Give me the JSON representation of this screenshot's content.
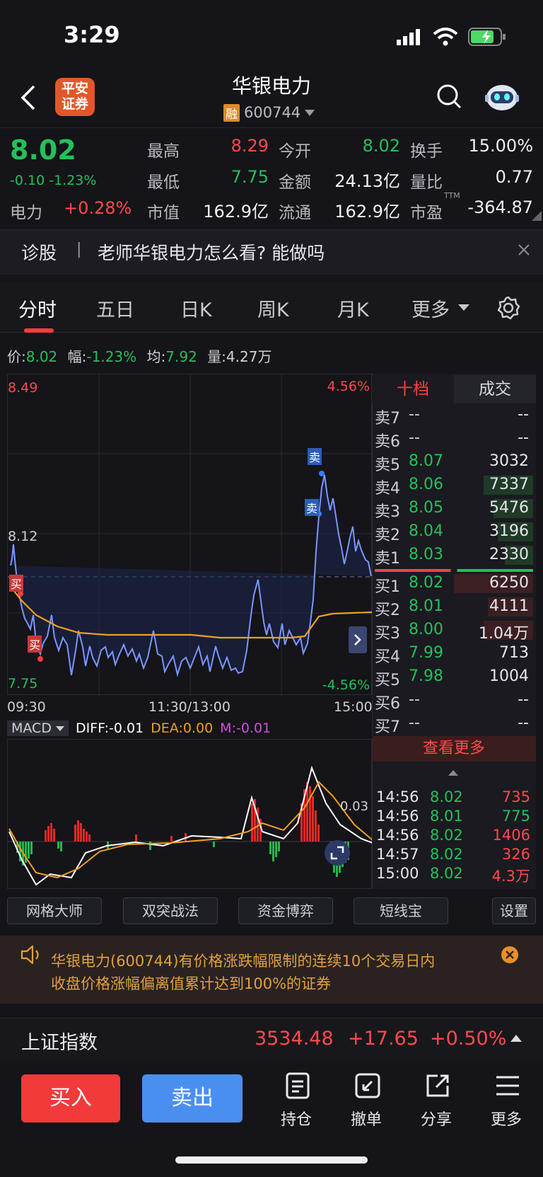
{
  "status": {
    "time": "3:29"
  },
  "header": {
    "logo_line1": "平安",
    "logo_line2": "证券",
    "title": "华银电力",
    "margin_badge": "融",
    "code": "600744"
  },
  "quote": {
    "price": "8.02",
    "change": "-0.10",
    "change_pct": "-1.23%",
    "sector_name": "电力",
    "sector_pct": "+0.28%",
    "high_lbl": "最高",
    "high": "8.29",
    "open_lbl": "今开",
    "open": "8.02",
    "turnover_lbl": "换手",
    "turnover": "15.00%",
    "low_lbl": "最低",
    "low": "7.75",
    "amount_lbl": "金额",
    "amount": "24.13亿",
    "vratio_lbl": "量比",
    "vratio": "0.77",
    "mcap_lbl": "市值",
    "mcap": "162.9亿",
    "float_lbl": "流通",
    "float": "162.9亿",
    "pe_lbl": "市盈",
    "pe_sup": "TTM",
    "pe": "-364.87"
  },
  "ask_bar": {
    "label": "诊股",
    "sep": "|",
    "question": "老师华银电力怎么看? 能做吗"
  },
  "tabs": {
    "t1": "分时",
    "t2": "五日",
    "t3": "日K",
    "t4": "周K",
    "t5": "月K",
    "t6": "更多"
  },
  "info_line": {
    "price_lbl": "价:",
    "price": "8.02",
    "amp_lbl": "幅:",
    "amp": "-1.23%",
    "avg_lbl": "均:",
    "avg": "7.92",
    "vol_lbl": "量:",
    "vol": "4.27万"
  },
  "chart_labels": {
    "top_price": "8.49",
    "top_pct": "4.56%",
    "mid_price": "8.12",
    "bottom_price": "7.75",
    "bottom_pct": "-4.56%",
    "t_start": "09:30",
    "t_mid": "11:30/13:00",
    "t_end": "15:00",
    "buy_mark": "买",
    "sell_mark": "卖"
  },
  "macd": {
    "name": "MACD",
    "diff": "DIFF:-0.01",
    "dea": "DEA:0.00",
    "m": "M:-0.01",
    "side_val": "0.03"
  },
  "orderbook": {
    "tab_active": "十档",
    "tab_other": "成交",
    "asks": [
      {
        "lbl": "卖7",
        "price": "--",
        "vol": "--"
      },
      {
        "lbl": "卖6",
        "price": "--",
        "vol": "--"
      },
      {
        "lbl": "卖5",
        "price": "8.07",
        "vol": "3032"
      },
      {
        "lbl": "卖4",
        "price": "8.06",
        "vol": "7337"
      },
      {
        "lbl": "卖3",
        "price": "8.05",
        "vol": "5476"
      },
      {
        "lbl": "卖2",
        "price": "8.04",
        "vol": "3196"
      },
      {
        "lbl": "卖1",
        "price": "8.03",
        "vol": "2330"
      }
    ],
    "bids": [
      {
        "lbl": "买1",
        "price": "8.02",
        "vol": "6250"
      },
      {
        "lbl": "买2",
        "price": "8.01",
        "vol": "4111"
      },
      {
        "lbl": "买3",
        "price": "8.00",
        "vol": "1.04万"
      },
      {
        "lbl": "买4",
        "price": "7.99",
        "vol": "713"
      },
      {
        "lbl": "买5",
        "price": "7.98",
        "vol": "1004"
      },
      {
        "lbl": "买6",
        "price": "--",
        "vol": "--"
      },
      {
        "lbl": "买7",
        "price": "--",
        "vol": "--"
      }
    ],
    "more": "查看更多",
    "trades": [
      {
        "t": "14:56",
        "p": "8.02",
        "v": "735"
      },
      {
        "t": "14:56",
        "p": "8.01",
        "v": "775"
      },
      {
        "t": "14:56",
        "p": "8.02",
        "v": "1406"
      },
      {
        "t": "14:57",
        "p": "8.02",
        "v": "326"
      },
      {
        "t": "15:00",
        "p": "8.02",
        "v": "4.3万"
      }
    ]
  },
  "tools": {
    "b1": "网格大师",
    "b2": "双突战法",
    "b3": "资金博弈",
    "b4": "短线宝",
    "b5": "设置"
  },
  "notice": {
    "line1": "华银电力(600744)有价格涨跌幅限制的连续10个交易日内",
    "line2": "收盘价格涨幅偏离值累计达到100%的证券"
  },
  "index": {
    "name": "上证指数",
    "value": "3534.48",
    "chg": "+17.65",
    "pct": "+0.50%"
  },
  "footer": {
    "buy": "买入",
    "sell": "卖出",
    "hold": "持仓",
    "cancel": "撤单",
    "share": "分享",
    "more": "更多"
  },
  "colors": {
    "up": "#ff4a4a",
    "down": "#25c05a",
    "price_line": "#6f8ff0",
    "avg_line": "#f0a020",
    "buy_btn": "#f23a3a",
    "sell_btn": "#4a8ff0"
  }
}
